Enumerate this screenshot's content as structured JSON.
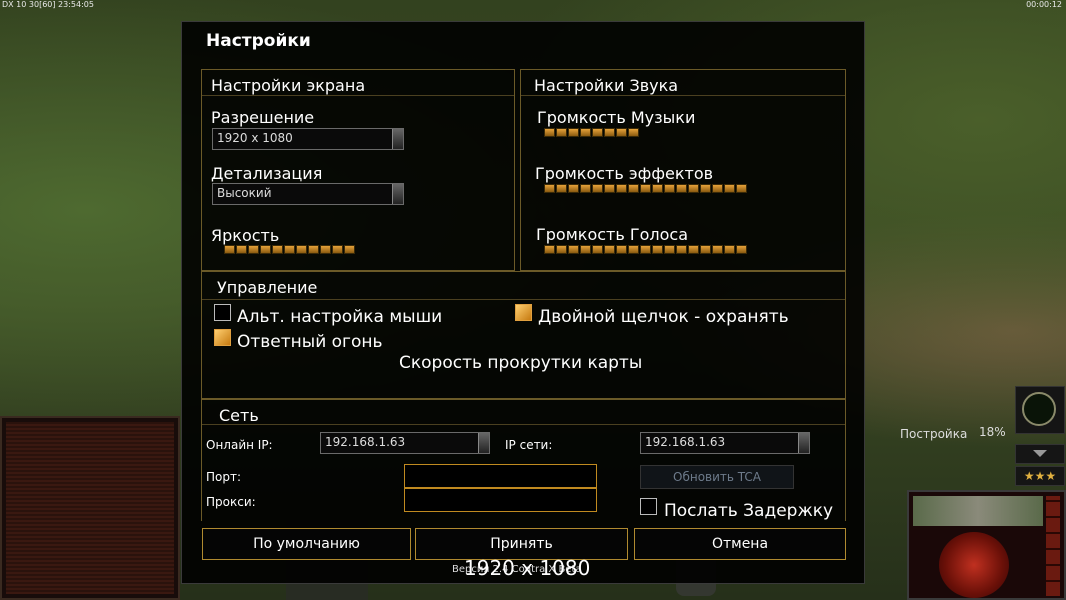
{
  "hud": {
    "top_left": "DX 10 30[60] 23:54:05",
    "top_right": "00:00:12",
    "build_label": "Постройка",
    "build_percent": "18%",
    "stars": "★★★"
  },
  "dialog": {
    "title": "Настройки",
    "display": {
      "header": "Настройки экрана",
      "resolution_label": "Разрешение",
      "resolution_value": "1920 x 1080",
      "detail_label": "Детализация",
      "detail_value": "Высокий",
      "brightness_label": "Яркость",
      "brightness_level": 11
    },
    "sound": {
      "header": "Настройки Звука",
      "music_label": "Громкость Музыки",
      "music_level": 8,
      "effects_label": "Громкость эффектов",
      "effects_level": 17,
      "voice_label": "Громкость Голоса",
      "voice_level": 17
    },
    "controls": {
      "header": "Управление",
      "alt_mouse_label": "Альт. настройка мыши",
      "alt_mouse_checked": false,
      "double_click_label": "Двойной щелчок - охранять",
      "double_click_checked": true,
      "return_fire_label": "Ответный огонь",
      "return_fire_checked": true,
      "scroll_speed_label": "Скорость прокрутки карты"
    },
    "network": {
      "header": "Сеть",
      "online_ip_label": "Онлайн IP:",
      "online_ip_value": "192.168.1.63",
      "lan_ip_label": "IP сети:",
      "lan_ip_value": "192.168.1.63",
      "port_label": "Порт:",
      "proxy_label": "Прокси:",
      "refresh_button": "Обновить TCA",
      "send_delay_label": "Послать Задержку",
      "send_delay_checked": false
    },
    "buttons": {
      "default": "По умолчанию",
      "accept": "Принять",
      "cancel": "Отмена"
    },
    "version_text": "Версия 2.4 Contra X Beta",
    "resolution_overlay": "1920 x 1080"
  }
}
